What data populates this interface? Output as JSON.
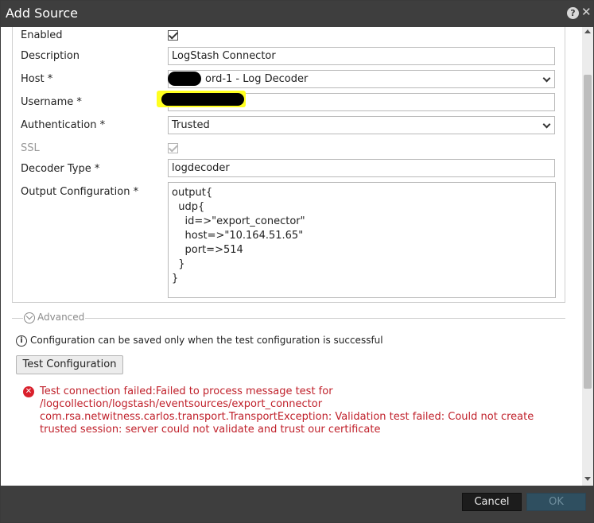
{
  "dialog": {
    "title": "Add Source",
    "help_icon": "help-icon",
    "close_icon": "close-icon"
  },
  "form": {
    "enabled": {
      "label": "Enabled",
      "checked": true
    },
    "description": {
      "label": "Description",
      "value": "LogStash Connector"
    },
    "host": {
      "label": "Host *",
      "value": "ord-1 - Log Decoder",
      "redacted_prefix": true
    },
    "username": {
      "label": "Username *",
      "value": "",
      "redacted": true
    },
    "authentication": {
      "label": "Authentication *",
      "value": "Trusted"
    },
    "ssl": {
      "label": "SSL",
      "checked": true,
      "disabled": true
    },
    "decoder_type": {
      "label": "Decoder Type *",
      "value": "logdecoder"
    },
    "output_configuration": {
      "label": "Output Configuration *",
      "lines": [
        "output{",
        "  udp{",
        "    id=>\"export_conector\"",
        "    host=>\"10.164.51.65\"",
        "    port=>514",
        "  }",
        "}"
      ]
    }
  },
  "advanced": {
    "label": "Advanced"
  },
  "info": {
    "text": "Configuration can be saved only when the test configuration is successful"
  },
  "test_button": {
    "label": "Test Configuration"
  },
  "error": {
    "lines": [
      "Test connection failed:Failed to process message test for",
      "/logcollection/logstash/eventsources/export_connector",
      "com.rsa.netwitness.carlos.transport.TransportException: Validation test failed: Could not create",
      "trusted session: server could not validate and trust our certificate"
    ]
  },
  "footer": {
    "cancel_label": "Cancel",
    "ok_label": "OK"
  },
  "colors": {
    "titlebar": "#3e3e3e",
    "error": "#c0212b",
    "highlight": "#ffff1f"
  }
}
